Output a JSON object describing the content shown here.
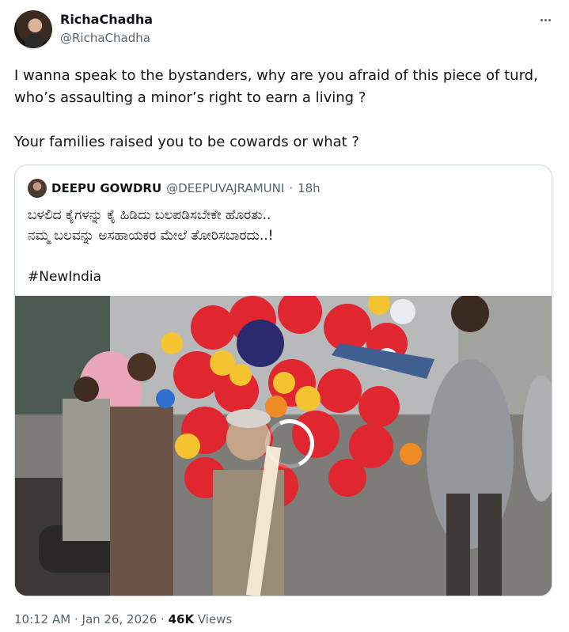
{
  "tweet": {
    "author_name": "RichaChadha",
    "author_handle": "@RichaChadha",
    "more_icon": "ellipsis-icon",
    "text_line1": "I wanna speak to the bystanders, why are you afraid of this piece of turd,",
    "text_line2": "who’s assaulting a minor’s right to earn a living ?",
    "text_line3": "Your families raised you to be cowards or what ?",
    "time": "10:12 AM",
    "separator": "·",
    "date": "Jan 26, 2026",
    "views_count": "46K",
    "views_label": "Views"
  },
  "quote": {
    "author_name": "DEEPU GOWDRU",
    "author_handle": "@DEEPUVAJRAMUNI",
    "separator": "·",
    "time": "18h",
    "text_line1": "ಬಳಲಿದ ಕೈಗಳನ್ನು ಕೈ ಹಿಡಿದು ಬಲಪಡಿಸಬೇಕೇ ಹೊರತು..",
    "text_line2": "ನಮ್ಮ ಬಲವನ್ನು ಅಸಹಾಯಕರ ಮೇಲೆ ತೋರಿಸಬಾರದು..!",
    "hashtag": "#NewIndia"
  },
  "colors": {
    "text_primary": "#0f1419",
    "text_secondary": "#536471",
    "border": "#cfd9de",
    "balloon_red": "#e0262f",
    "balloon_yellow": "#f4c430"
  }
}
